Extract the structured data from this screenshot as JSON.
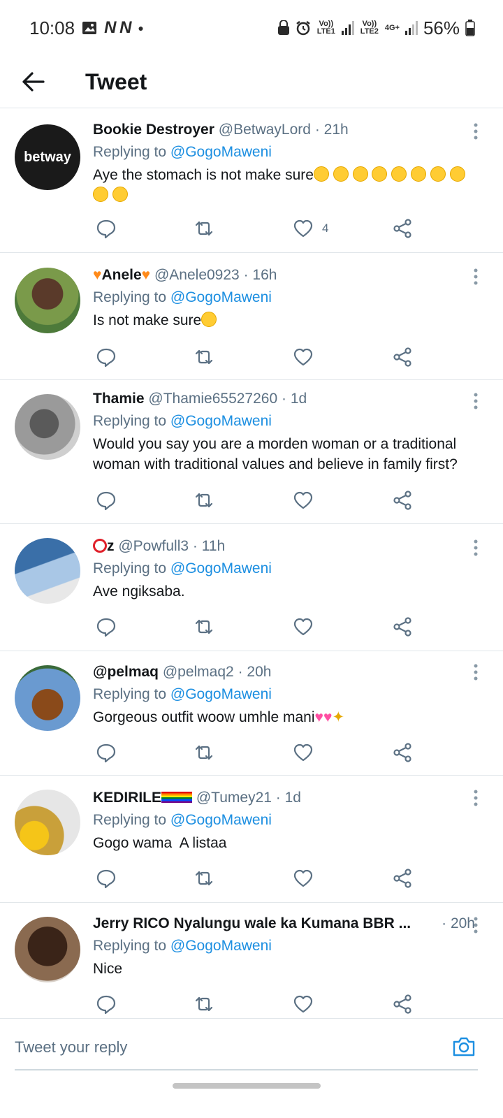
{
  "status": {
    "time": "10:08",
    "notif_icons": "N N",
    "net1": "Vo)) LTE1",
    "net2": "Vo)) LTE2",
    "net3": "4G+",
    "battery": "56%"
  },
  "header": {
    "title": "Tweet"
  },
  "replying_label": "Replying to",
  "tweets": [
    {
      "name": "Bookie Destroyer",
      "handle": "@BetwayLord",
      "time": "· 21h",
      "mention": "@GogoMaweni",
      "text": "Aye the stomach is not make sure",
      "likes": "4",
      "avatar_text": "betway"
    },
    {
      "name": "Anele",
      "handle": "@Anele0923",
      "time": "· 16h",
      "mention": "@GogoMaweni",
      "text": "Is not make sure",
      "likes": ""
    },
    {
      "name": "Thamie",
      "handle": "@Thamie65527260",
      "time": "· 1d",
      "mention": "@GogoMaweni",
      "text": "Would you say you are a morden woman or a traditional woman with traditional values and believe in family first?",
      "likes": ""
    },
    {
      "name": "z",
      "handle": "@Powfull3",
      "time": "· 11h",
      "mention": "@GogoMaweni",
      "text": "Ave ngiksaba.",
      "likes": ""
    },
    {
      "name": "@pelmaq",
      "handle": "@pelmaq2",
      "time": "· 20h",
      "mention": "@GogoMaweni",
      "text": "Gorgeous outfit woow umhle mani",
      "likes": ""
    },
    {
      "name": "KEDIRILE",
      "handle": "@Tumey21",
      "time": "· 1d",
      "mention": "@GogoMaweni",
      "text": "Gogo wama  A listaa",
      "likes": ""
    },
    {
      "name": "Jerry RICO Nyalungu wale ka Kumana BBR ...",
      "handle": "",
      "time": "· 20h",
      "mention": "@GogoMaweni",
      "text": "Nice",
      "likes": ""
    }
  ],
  "reply_bar": {
    "placeholder": "Tweet your reply"
  },
  "colors": {
    "link": "#1d8fe1",
    "muted": "#5b7083",
    "divider": "#e1e6ea"
  }
}
